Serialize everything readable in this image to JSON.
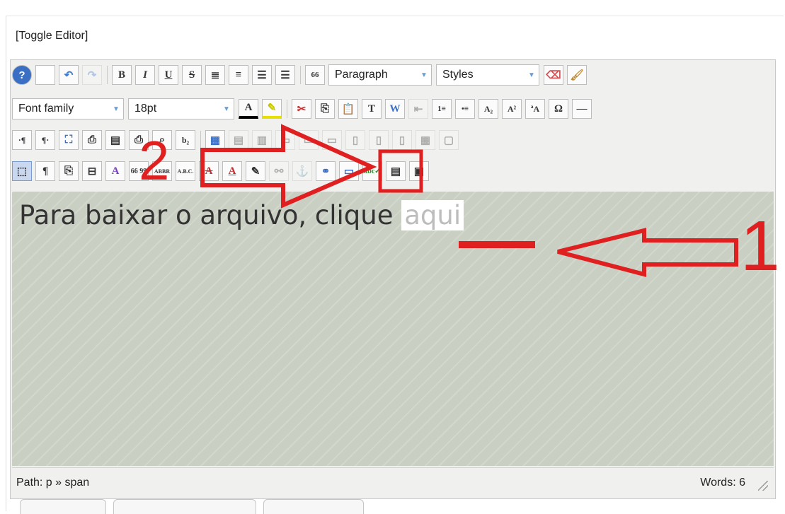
{
  "toggle_label": "[Toggle Editor]",
  "toolbar": {
    "row1": {
      "bold": "B",
      "italic": "I",
      "underline": "U",
      "strike": "S",
      "blockquote": "66",
      "format_select": "Paragraph",
      "styles_select": "Styles"
    },
    "row2": {
      "font_family": "Font family",
      "font_size": "18pt",
      "subscript": "A₂",
      "superscript": "A²",
      "omega": "Ω"
    }
  },
  "content": {
    "text_before": "Para baixar o arquivo, clique ",
    "highlighted": "aqui"
  },
  "statusbar": {
    "path": "Path: p » span",
    "words": "Words: 6"
  },
  "annotations": {
    "label_1": "1",
    "label_2": "2",
    "color": "#e02020"
  },
  "colors": {
    "content_bg": "#c9cfc2",
    "toolbar_bg": "#f0f0ee",
    "highlight": "#ffffff"
  }
}
